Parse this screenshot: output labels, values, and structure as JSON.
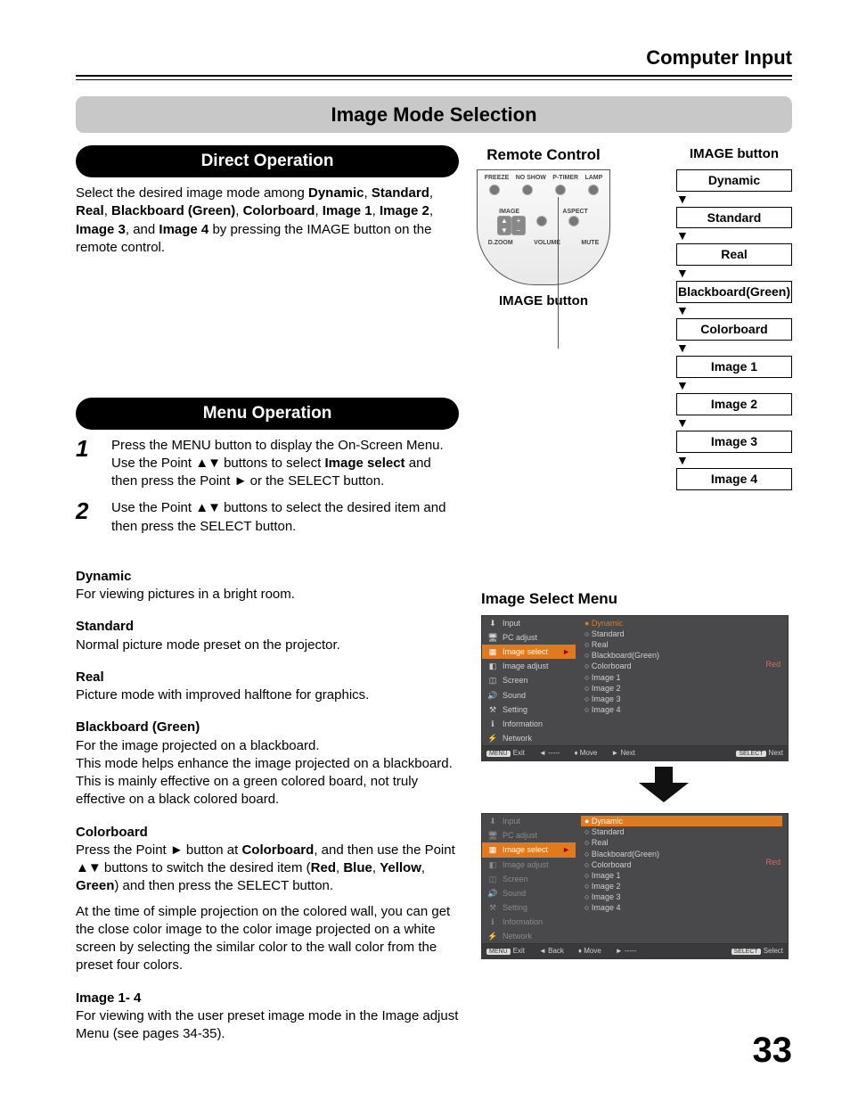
{
  "header": {
    "section": "Computer Input"
  },
  "banner": "Image Mode Selection",
  "direct": {
    "title": "Direct Operation",
    "body_pre": "Select the desired image mode among ",
    "body_post": " by pressing the IMAGE button on the remote control.",
    "modes_inline": [
      "Dynamic",
      "Standard",
      "Real",
      "Blackboard (Green)",
      "Colorboard",
      "Image 1",
      "Image 2",
      "Image 3",
      "Image 4"
    ]
  },
  "remote": {
    "title": "Remote Control",
    "caption": "IMAGE button",
    "top_row": [
      "FREEZE",
      "NO SHOW",
      "P-TIMER",
      "LAMP"
    ],
    "mid_row": [
      "IMAGE",
      "ASPECT"
    ],
    "bot_row": [
      "D.ZOOM",
      "VOLUME",
      "MUTE"
    ]
  },
  "mode_chain": {
    "label": "IMAGE button",
    "items": [
      "Dynamic",
      "Standard",
      "Real",
      "Blackboard(Green)",
      "Colorboard",
      "Image 1",
      "Image 2",
      "Image 3",
      "Image 4"
    ]
  },
  "menu": {
    "title": "Menu Operation",
    "steps": [
      {
        "n": "1",
        "text_pre": "Press the MENU button to display the On-Screen Menu. Use the Point ",
        "arrows1": "▲▼",
        "text_mid1": " buttons to select ",
        "bold1": "Image select",
        "text_mid2": " and then press the Point ",
        "arrows2": "►",
        "text_post": " or the SELECT button."
      },
      {
        "n": "2",
        "text_pre": "Use the Point ",
        "arrows1": "▲▼",
        "text_mid1": " buttons to select the desired item and then press the SELECT button.",
        "bold1": "",
        "text_mid2": "",
        "arrows2": "",
        "text_post": ""
      }
    ]
  },
  "defs": [
    {
      "h": "Dynamic",
      "body": "For viewing pictures in a bright room."
    },
    {
      "h": "Standard",
      "body": "Normal picture mode preset on the projector."
    },
    {
      "h": "Real",
      "body": "Picture mode with improved halftone for graphics."
    },
    {
      "h": "Blackboard (Green)",
      "body": "For the image projected on a blackboard.\nThis mode helps enhance the image projected on a blackboard. This is mainly effective on a green colored board, not truly effective on a black colored board."
    }
  ],
  "colorboard": {
    "h": "Colorboard",
    "p1_pre": "Press the Point ",
    "p1_arr1": "►",
    "p1_mid1": " button at ",
    "p1_bold": "Colorboard",
    "p1_mid2": ", and then use the Point ",
    "p1_arr2": "▲▼",
    "p1_mid3": " buttons to switch the desired item (",
    "p1_colors": [
      "Red",
      "Blue",
      "Yellow",
      "Green"
    ],
    "p1_post": ") and then press the SELECT button.",
    "p2": "At the time of simple projection on the colored wall, you can get the close color image to the color image projected on a white screen by selecting the similar color to the wall color from the preset four colors."
  },
  "img14": {
    "h": "Image 1- 4",
    "body": "For viewing with the user preset image mode in the Image adjust Menu (see pages 34-35)."
  },
  "osd": {
    "title": "Image Select Menu",
    "sidebar": [
      "Input",
      "PC adjust",
      "Image select",
      "Image adjust",
      "Screen",
      "Sound",
      "Setting",
      "Information",
      "Network"
    ],
    "icons": [
      "⬇",
      "🖥",
      "▦",
      "◧",
      "◫",
      "🔊",
      "⚒",
      "ℹ",
      "⚡"
    ],
    "options": [
      "Dynamic",
      "Standard",
      "Real",
      "Blackboard(Green)",
      "Colorboard",
      "Image 1",
      "Image 2",
      "Image 3",
      "Image 4"
    ],
    "side_note": "Red",
    "footer1": {
      "exit_key": "MENU",
      "exit": "Exit",
      "back": "-----",
      "move": "Move",
      "next": "Next",
      "sel_key": "SELECT",
      "sel": "Next"
    },
    "footer2": {
      "exit_key": "MENU",
      "exit": "Exit",
      "back": "Back",
      "move": "Move",
      "next": "-----",
      "sel_key": "SELECT",
      "sel": "Select"
    }
  },
  "page_num": "33"
}
